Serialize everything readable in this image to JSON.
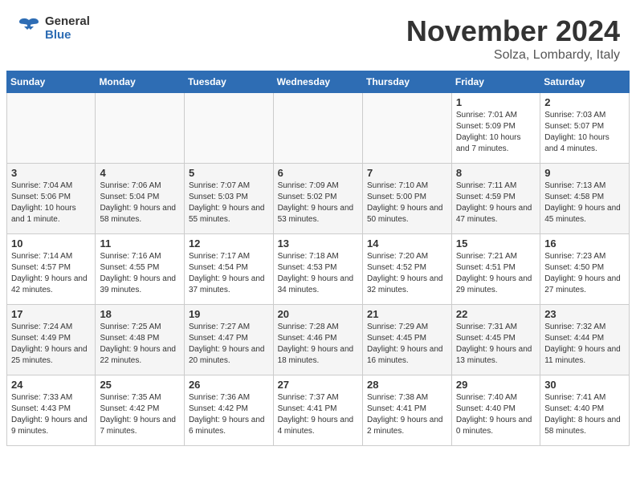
{
  "header": {
    "logo_general": "General",
    "logo_blue": "Blue",
    "month_title": "November 2024",
    "location": "Solza, Lombardy, Italy"
  },
  "weekdays": [
    "Sunday",
    "Monday",
    "Tuesday",
    "Wednesday",
    "Thursday",
    "Friday",
    "Saturday"
  ],
  "weeks": [
    [
      {
        "day": "",
        "info": ""
      },
      {
        "day": "",
        "info": ""
      },
      {
        "day": "",
        "info": ""
      },
      {
        "day": "",
        "info": ""
      },
      {
        "day": "",
        "info": ""
      },
      {
        "day": "1",
        "info": "Sunrise: 7:01 AM\nSunset: 5:09 PM\nDaylight: 10 hours and 7 minutes."
      },
      {
        "day": "2",
        "info": "Sunrise: 7:03 AM\nSunset: 5:07 PM\nDaylight: 10 hours and 4 minutes."
      }
    ],
    [
      {
        "day": "3",
        "info": "Sunrise: 7:04 AM\nSunset: 5:06 PM\nDaylight: 10 hours and 1 minute."
      },
      {
        "day": "4",
        "info": "Sunrise: 7:06 AM\nSunset: 5:04 PM\nDaylight: 9 hours and 58 minutes."
      },
      {
        "day": "5",
        "info": "Sunrise: 7:07 AM\nSunset: 5:03 PM\nDaylight: 9 hours and 55 minutes."
      },
      {
        "day": "6",
        "info": "Sunrise: 7:09 AM\nSunset: 5:02 PM\nDaylight: 9 hours and 53 minutes."
      },
      {
        "day": "7",
        "info": "Sunrise: 7:10 AM\nSunset: 5:00 PM\nDaylight: 9 hours and 50 minutes."
      },
      {
        "day": "8",
        "info": "Sunrise: 7:11 AM\nSunset: 4:59 PM\nDaylight: 9 hours and 47 minutes."
      },
      {
        "day": "9",
        "info": "Sunrise: 7:13 AM\nSunset: 4:58 PM\nDaylight: 9 hours and 45 minutes."
      }
    ],
    [
      {
        "day": "10",
        "info": "Sunrise: 7:14 AM\nSunset: 4:57 PM\nDaylight: 9 hours and 42 minutes."
      },
      {
        "day": "11",
        "info": "Sunrise: 7:16 AM\nSunset: 4:55 PM\nDaylight: 9 hours and 39 minutes."
      },
      {
        "day": "12",
        "info": "Sunrise: 7:17 AM\nSunset: 4:54 PM\nDaylight: 9 hours and 37 minutes."
      },
      {
        "day": "13",
        "info": "Sunrise: 7:18 AM\nSunset: 4:53 PM\nDaylight: 9 hours and 34 minutes."
      },
      {
        "day": "14",
        "info": "Sunrise: 7:20 AM\nSunset: 4:52 PM\nDaylight: 9 hours and 32 minutes."
      },
      {
        "day": "15",
        "info": "Sunrise: 7:21 AM\nSunset: 4:51 PM\nDaylight: 9 hours and 29 minutes."
      },
      {
        "day": "16",
        "info": "Sunrise: 7:23 AM\nSunset: 4:50 PM\nDaylight: 9 hours and 27 minutes."
      }
    ],
    [
      {
        "day": "17",
        "info": "Sunrise: 7:24 AM\nSunset: 4:49 PM\nDaylight: 9 hours and 25 minutes."
      },
      {
        "day": "18",
        "info": "Sunrise: 7:25 AM\nSunset: 4:48 PM\nDaylight: 9 hours and 22 minutes."
      },
      {
        "day": "19",
        "info": "Sunrise: 7:27 AM\nSunset: 4:47 PM\nDaylight: 9 hours and 20 minutes."
      },
      {
        "day": "20",
        "info": "Sunrise: 7:28 AM\nSunset: 4:46 PM\nDaylight: 9 hours and 18 minutes."
      },
      {
        "day": "21",
        "info": "Sunrise: 7:29 AM\nSunset: 4:45 PM\nDaylight: 9 hours and 16 minutes."
      },
      {
        "day": "22",
        "info": "Sunrise: 7:31 AM\nSunset: 4:45 PM\nDaylight: 9 hours and 13 minutes."
      },
      {
        "day": "23",
        "info": "Sunrise: 7:32 AM\nSunset: 4:44 PM\nDaylight: 9 hours and 11 minutes."
      }
    ],
    [
      {
        "day": "24",
        "info": "Sunrise: 7:33 AM\nSunset: 4:43 PM\nDaylight: 9 hours and 9 minutes."
      },
      {
        "day": "25",
        "info": "Sunrise: 7:35 AM\nSunset: 4:42 PM\nDaylight: 9 hours and 7 minutes."
      },
      {
        "day": "26",
        "info": "Sunrise: 7:36 AM\nSunset: 4:42 PM\nDaylight: 9 hours and 6 minutes."
      },
      {
        "day": "27",
        "info": "Sunrise: 7:37 AM\nSunset: 4:41 PM\nDaylight: 9 hours and 4 minutes."
      },
      {
        "day": "28",
        "info": "Sunrise: 7:38 AM\nSunset: 4:41 PM\nDaylight: 9 hours and 2 minutes."
      },
      {
        "day": "29",
        "info": "Sunrise: 7:40 AM\nSunset: 4:40 PM\nDaylight: 9 hours and 0 minutes."
      },
      {
        "day": "30",
        "info": "Sunrise: 7:41 AM\nSunset: 4:40 PM\nDaylight: 8 hours and 58 minutes."
      }
    ]
  ]
}
